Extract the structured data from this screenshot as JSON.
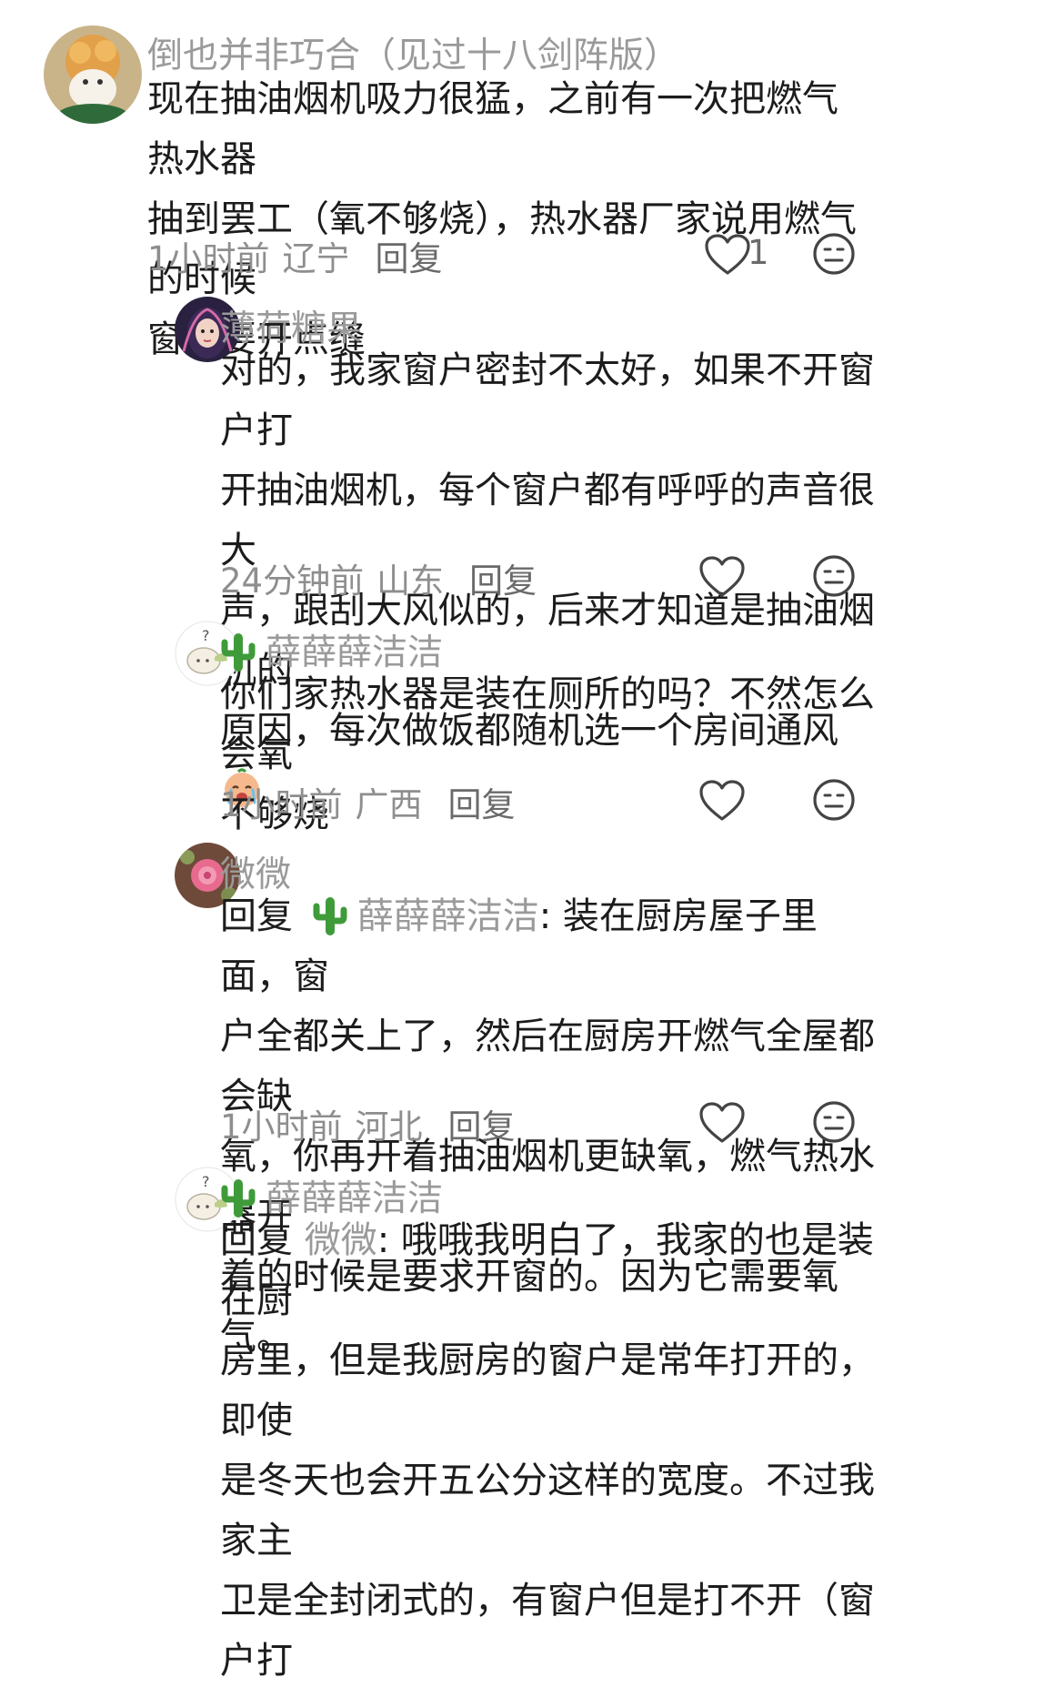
{
  "comments": [
    {
      "username": "倒也并非巧合（见过十八剑阵版）",
      "text_lines": [
        "现在抽油烟机吸力很猛，之前有一次把燃气热水器",
        "抽到罢工（氧不够烧），热水器厂家说用燃气的时候",
        "窗户要开点缝"
      ],
      "time": "1小时前",
      "location": "辽宁",
      "reply_label": "回复",
      "like_count": "1",
      "icons": [
        "heart-icon",
        "neutral-face-icon"
      ]
    },
    {
      "username": "薄荷糖果",
      "text_lines": [
        "对的，我家窗户密封不太好，如果不开窗户打",
        "开抽油烟机，每个窗户都有呼呼的声音很大",
        "声，跟刮大风似的，后来才知道是抽油烟机的",
        "原因，每次做饭都随机选一个房间通风"
      ],
      "time": "24分钟前",
      "location": "山东",
      "reply_label": "回复",
      "icons": [
        "crying-emoji-icon",
        "heart-icon",
        "neutral-face-icon"
      ]
    },
    {
      "username": "薛薛薛洁洁",
      "text_lines": [
        "你们家热水器是装在厕所的吗？不然怎么会氧",
        "不够烧"
      ],
      "time": "1小时前",
      "location": "广西",
      "reply_label": "回复",
      "icons": [
        "cactus-icon",
        "heart-icon",
        "neutral-face-icon"
      ]
    },
    {
      "username": "微微",
      "reply_prefix": "回复",
      "reply_to": "薛薛薛洁洁",
      "text_first": ": 装在厨房屋子里面，窗",
      "text_lines": [
        "户全都关上了，然后在厨房开燃气全屋都会缺",
        "氧，你再开着抽油烟机更缺氧，燃气热水器开",
        "着的时候是要求开窗的。因为它需要氧气。"
      ],
      "time": "1小时前",
      "location": "河北",
      "reply_label": "回复",
      "icons": [
        "cactus-icon",
        "heart-icon",
        "neutral-face-icon"
      ]
    },
    {
      "username": "薛薛薛洁洁",
      "reply_prefix": "回复",
      "reply_to": "微微",
      "text_first": ": 哦哦我明白了，我家的也是装在厨",
      "text_lines": [
        "房里，但是我厨房的窗户是常年打开的，即使",
        "是冬天也会开五公分这样的宽度。不过我家主",
        "卫是全封闭式的，有窗户但是打不开（窗户打"
      ],
      "icons": [
        "cactus-icon"
      ]
    }
  ],
  "colors": {
    "text": "#1c1c1c",
    "username": "#9a9a9a",
    "meta": "#8e8e8e",
    "cactus": "#3f9b3a"
  }
}
